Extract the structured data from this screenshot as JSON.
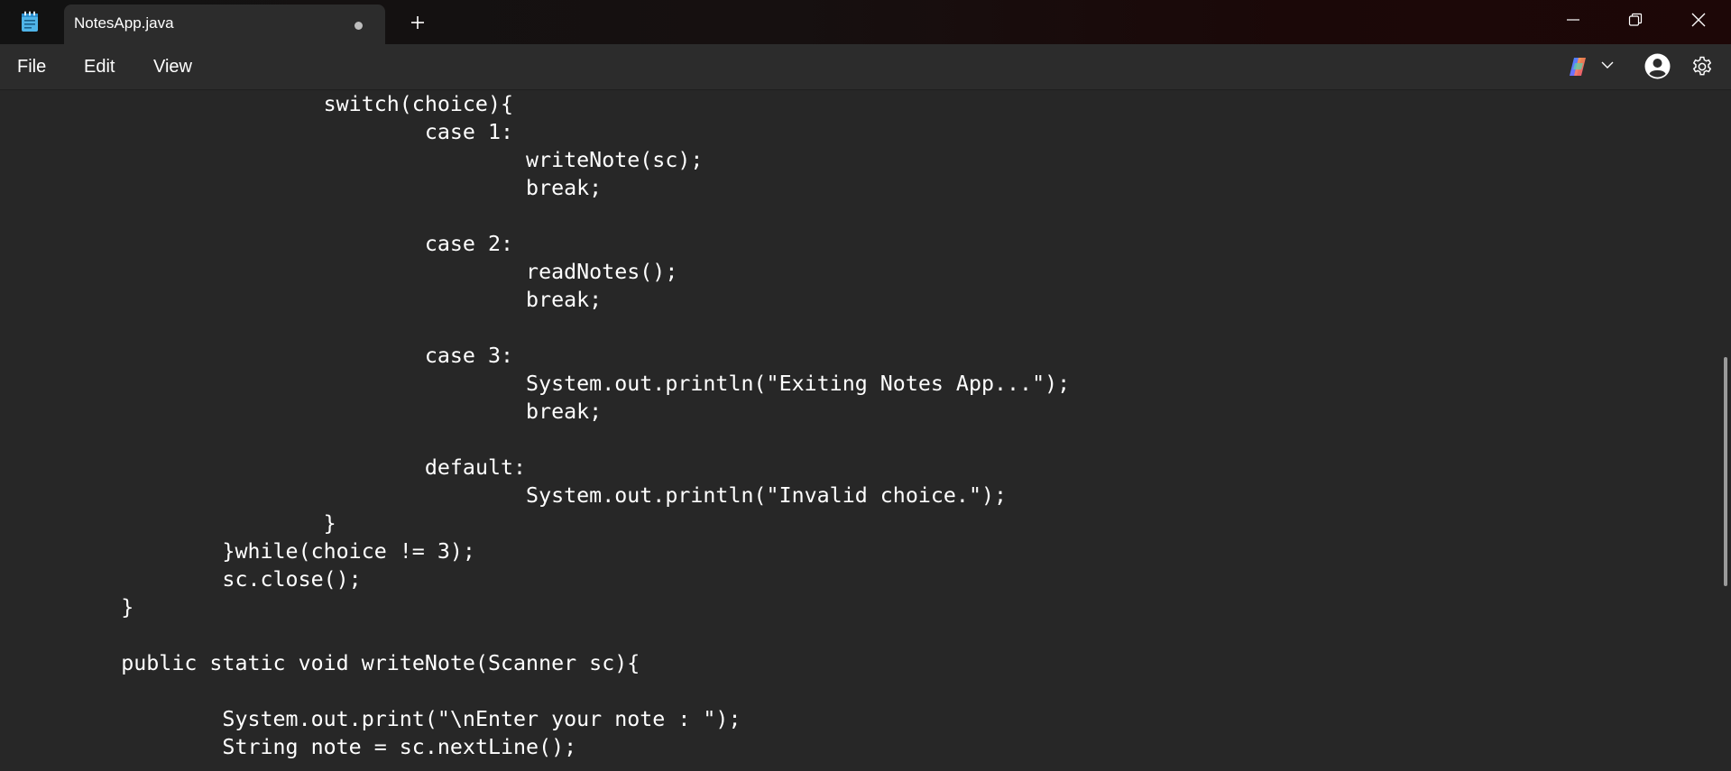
{
  "window": {
    "tab_title": "NotesApp.java"
  },
  "menu": {
    "file": "File",
    "edit": "Edit",
    "view": "View"
  },
  "icons": {
    "app": "notepad-icon",
    "new_tab": "plus-icon",
    "minimize": "minimize-icon",
    "maximize": "restore-icon",
    "close": "close-icon",
    "copilot": "copilot-icon",
    "account": "account-icon",
    "settings": "gear-icon",
    "unsaved": "unsaved-dot-icon"
  },
  "colors": {
    "editor_bg": "#272727",
    "menubar_bg": "#2c2c2c",
    "text": "#ffffff"
  },
  "editor": {
    "lines": [
      "\t\t\tswitch(choice){",
      "\t\t\t\tcase 1:",
      "\t\t\t\t\twriteNote(sc);",
      "\t\t\t\t\tbreak;",
      "",
      "\t\t\t\tcase 2:",
      "\t\t\t\t\treadNotes();",
      "\t\t\t\t\tbreak;",
      "",
      "\t\t\t\tcase 3:",
      "\t\t\t\t\tSystem.out.println(\"Exiting Notes App...\");",
      "\t\t\t\t\tbreak;",
      "",
      "\t\t\t\tdefault:",
      "\t\t\t\t\tSystem.out.println(\"Invalid choice.\");",
      "\t\t\t}",
      "\t\t}while(choice != 3);",
      "\t\tsc.close();",
      "\t}",
      "",
      "\tpublic static void writeNote(Scanner sc){",
      "",
      "\t\tSystem.out.print(\"\\nEnter your note : \");",
      "\t\tString note = sc.nextLine();"
    ]
  }
}
